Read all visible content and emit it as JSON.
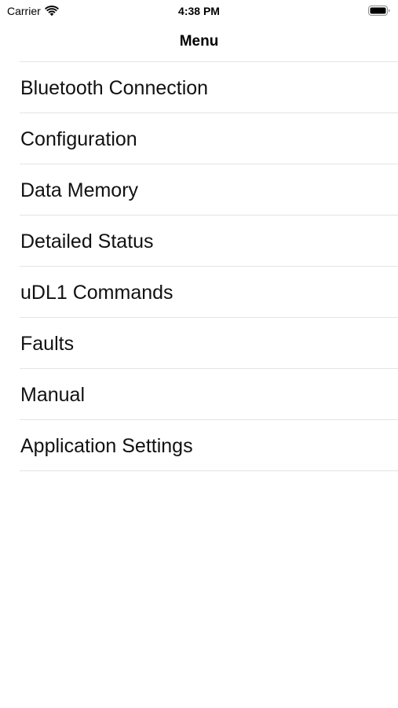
{
  "status_bar": {
    "carrier": "Carrier",
    "time": "4:38 PM",
    "icons": [
      "wifi-icon",
      "battery-icon"
    ]
  },
  "nav_bar": {
    "title": "Menu"
  },
  "menu": {
    "items": [
      {
        "label": "Bluetooth Connection"
      },
      {
        "label": "Configuration"
      },
      {
        "label": "Data Memory"
      },
      {
        "label": "Detailed Status"
      },
      {
        "label": "uDL1 Commands"
      },
      {
        "label": "Faults"
      },
      {
        "label": "Manual"
      },
      {
        "label": "Application Settings"
      }
    ]
  },
  "colors": {
    "background": "#ffffff",
    "text": "#111111",
    "separator": "#e4e4e6"
  }
}
